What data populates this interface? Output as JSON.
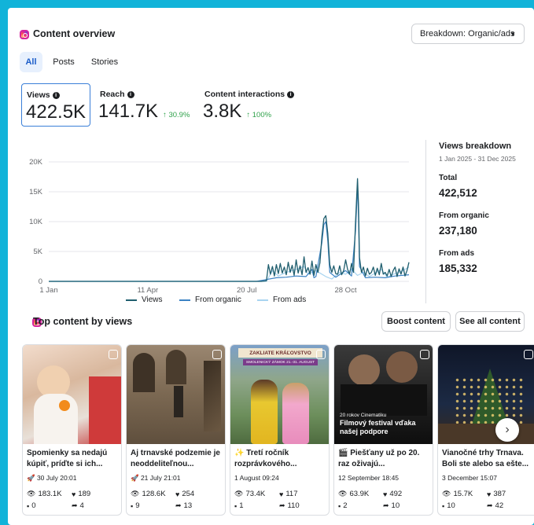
{
  "header": {
    "title": "Content overview",
    "breakdown_label": "Breakdown: Organic/ads"
  },
  "tabs": [
    {
      "label": "All",
      "active": true
    },
    {
      "label": "Posts",
      "active": false
    },
    {
      "label": "Stories",
      "active": false
    }
  ],
  "metrics": [
    {
      "label": "Views",
      "value": "422.5K",
      "delta": ""
    },
    {
      "label": "Reach",
      "value": "141.7K",
      "delta": "↑ 30.9%"
    },
    {
      "label": "Content interactions",
      "value": "3.8K",
      "delta": "↑ 100%"
    }
  ],
  "chart_data": {
    "type": "line",
    "x_tick_labels": [
      "1 Jan",
      "11 Apr",
      "20 Jul",
      "28 Oct"
    ],
    "y_tick_labels": [
      "20K",
      "15K",
      "10K",
      "5K",
      "0"
    ],
    "ylim": [
      0,
      20000
    ],
    "x_range_days": [
      0,
      364
    ],
    "series": [
      {
        "name": "Views",
        "color": "#1f5e6e",
        "points": [
          [
            0,
            0
          ],
          [
            200,
            0
          ],
          [
            215,
            0
          ],
          [
            220,
            100
          ],
          [
            222,
            2800
          ],
          [
            224,
            1200
          ],
          [
            226,
            2500
          ],
          [
            228,
            900
          ],
          [
            230,
            2800
          ],
          [
            232,
            1300
          ],
          [
            234,
            3000
          ],
          [
            236,
            1400
          ],
          [
            238,
            2400
          ],
          [
            240,
            1100
          ],
          [
            242,
            3200
          ],
          [
            244,
            1500
          ],
          [
            246,
            2700
          ],
          [
            248,
            1000
          ],
          [
            250,
            3600
          ],
          [
            252,
            1400
          ],
          [
            254,
            2600
          ],
          [
            256,
            1100
          ],
          [
            258,
            4100
          ],
          [
            260,
            1500
          ],
          [
            262,
            2300
          ],
          [
            264,
            1200
          ],
          [
            266,
            3400
          ],
          [
            268,
            1000
          ],
          [
            270,
            2800
          ],
          [
            272,
            1500
          ],
          [
            274,
            3100
          ],
          [
            276,
            7500
          ],
          [
            278,
            10500
          ],
          [
            280,
            11000
          ],
          [
            282,
            8000
          ],
          [
            284,
            2800
          ],
          [
            286,
            1500
          ],
          [
            288,
            2600
          ],
          [
            290,
            1300
          ],
          [
            292,
            1200
          ],
          [
            294,
            2600
          ],
          [
            296,
            1100
          ],
          [
            298,
            1800
          ],
          [
            300,
            3600
          ],
          [
            302,
            2000
          ],
          [
            304,
            1200
          ],
          [
            306,
            3000
          ],
          [
            308,
            1500
          ],
          [
            310,
            10000
          ],
          [
            312,
            17200
          ],
          [
            313,
            13000
          ],
          [
            314,
            4000
          ],
          [
            316,
            1500
          ],
          [
            318,
            2400
          ],
          [
            320,
            900
          ],
          [
            322,
            2200
          ],
          [
            324,
            1200
          ],
          [
            326,
            1500
          ],
          [
            328,
            2400
          ],
          [
            330,
            1000
          ],
          [
            332,
            2200
          ],
          [
            334,
            1100
          ],
          [
            336,
            3000
          ],
          [
            338,
            1200
          ],
          [
            340,
            1500
          ],
          [
            342,
            900
          ],
          [
            344,
            2000
          ],
          [
            346,
            800
          ],
          [
            348,
            1800
          ],
          [
            350,
            2400
          ],
          [
            352,
            800
          ],
          [
            354,
            2100
          ],
          [
            356,
            1200
          ],
          [
            358,
            2400
          ],
          [
            360,
            900
          ],
          [
            362,
            1800
          ],
          [
            364,
            3200
          ]
        ]
      },
      {
        "name": "From organic",
        "color": "#3b82c4",
        "points": [
          [
            0,
            0
          ],
          [
            210,
            0
          ],
          [
            220,
            300
          ],
          [
            230,
            600
          ],
          [
            240,
            700
          ],
          [
            250,
            900
          ],
          [
            260,
            800
          ],
          [
            266,
            2000
          ],
          [
            268,
            600
          ],
          [
            270,
            800
          ],
          [
            276,
            6500
          ],
          [
            278,
            9500
          ],
          [
            280,
            10000
          ],
          [
            282,
            6800
          ],
          [
            284,
            1500
          ],
          [
            290,
            700
          ],
          [
            300,
            1800
          ],
          [
            306,
            900
          ],
          [
            310,
            8500
          ],
          [
            312,
            16000
          ],
          [
            313,
            11000
          ],
          [
            314,
            2500
          ],
          [
            320,
            600
          ],
          [
            330,
            700
          ],
          [
            340,
            600
          ],
          [
            350,
            900
          ],
          [
            364,
            1100
          ]
        ]
      },
      {
        "name": "From ads",
        "color": "#a8d4f0",
        "points": [
          [
            0,
            0
          ],
          [
            220,
            0
          ],
          [
            226,
            1800
          ],
          [
            232,
            900
          ],
          [
            240,
            1500
          ],
          [
            250,
            2000
          ],
          [
            258,
            2500
          ],
          [
            262,
            1200
          ],
          [
            270,
            1800
          ],
          [
            280,
            800
          ],
          [
            286,
            400
          ],
          [
            294,
            1500
          ],
          [
            300,
            1200
          ],
          [
            306,
            2000
          ],
          [
            312,
            1000
          ],
          [
            318,
            1500
          ],
          [
            324,
            800
          ],
          [
            330,
            1400
          ],
          [
            336,
            2000
          ],
          [
            342,
            700
          ],
          [
            350,
            1300
          ],
          [
            358,
            1800
          ],
          [
            364,
            2400
          ]
        ]
      }
    ]
  },
  "breakdown": {
    "title": "Views breakdown",
    "range": "1 Jan 2025 - 31 Dec 2025",
    "items": [
      {
        "label": "Total",
        "value": "422,512"
      },
      {
        "label": "From organic",
        "value": "237,180"
      },
      {
        "label": "From ads",
        "value": "185,332"
      }
    ]
  },
  "top_content": {
    "title": "Top content by views",
    "boost_label": "Boost content",
    "see_all_label": "See all content",
    "posts": [
      {
        "caption": "Spomienky sa nedajú kúpiť, príďte si ich...",
        "date": "🚀 30 July 20:01",
        "views": "183.1K",
        "likes": "189",
        "comments": "0",
        "shares": "4",
        "theme": "#c8a48a"
      },
      {
        "caption": "Aj trnavské podzemie je neoddeliteľnou...",
        "date": "🚀 21 July 21:01",
        "views": "128.6K",
        "likes": "254",
        "comments": "9",
        "shares": "13",
        "theme": "#8a7560"
      },
      {
        "caption": "✨ Tretí ročník rozprávkového...",
        "date": "1 August 09:24",
        "views": "73.4K",
        "likes": "117",
        "comments": "1",
        "shares": "110",
        "theme": "#6a8e5a",
        "overlay_top": "ZAKLIATE KRÁĽOVSTVO",
        "overlay_sub": "SMOLENICKÝ ZÁMOK  21.-31. AUGUST"
      },
      {
        "caption": "🎬 Piešťany už po 20. raz oživajú...",
        "date": "12 September 18:45",
        "views": "63.9K",
        "likes": "492",
        "comments": "2",
        "shares": "10",
        "theme": "#2b2b2b",
        "overlay_small": "20 rokov Cinematiku",
        "overlay_big": "Filmový festival vďaka našej podpore"
      },
      {
        "caption": "Vianočné trhy Trnava. Boli ste alebo sa ešte...",
        "date": "3 December 15:07",
        "views": "15.7K",
        "likes": "387",
        "comments": "10",
        "shares": "42",
        "theme": "#1a2438"
      }
    ]
  },
  "icons": {
    "info": "info-icon",
    "chevron": "caret-down-icon",
    "next": "chevron-right-icon",
    "views": "eye-icon",
    "likes": "heart-icon",
    "comments": "comment-icon",
    "shares": "share-icon"
  }
}
